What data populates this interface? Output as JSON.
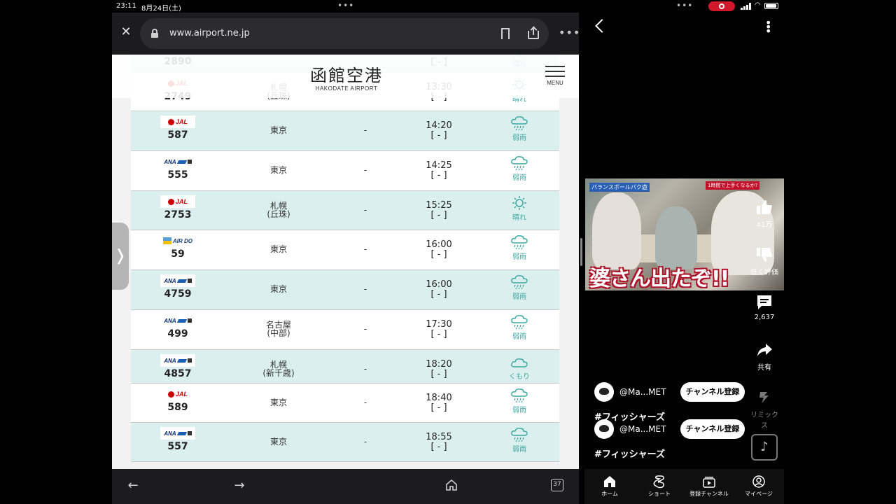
{
  "status_bar": {
    "time": "23:11",
    "date": "8月24日(土)",
    "dots": "•••"
  },
  "browser": {
    "url": "www.airport.ne.jp",
    "close_icon": "close-icon",
    "tabs_count": "37"
  },
  "site": {
    "logo": "函館空港",
    "logo_sub": "HAKODATE AIRPORT",
    "menu_label": "MENU"
  },
  "flights": [
    {
      "airline": "",
      "flight": "2890",
      "dest": "",
      "via": "",
      "time": "",
      "status": "[ - ]",
      "weather": "晴れ",
      "weather_icon": "sun-icon",
      "bg": "teal"
    },
    {
      "airline": "JAL",
      "flight": "2749",
      "dest": "札幌",
      "dest2": "(丘珠)",
      "via": "",
      "time": "13:30",
      "status": "[ - ]",
      "weather": "晴れ",
      "weather_icon": "sun-icon",
      "bg": "white"
    },
    {
      "airline": "JAL",
      "flight": "587",
      "dest": "東京",
      "dest2": "",
      "via": "-",
      "time": "14:20",
      "status": "[ - ]",
      "weather": "弱雨",
      "weather_icon": "rain-icon",
      "bg": "teal"
    },
    {
      "airline": "ANA",
      "flight": "555",
      "dest": "東京",
      "dest2": "",
      "via": "-",
      "time": "14:25",
      "status": "[ - ]",
      "weather": "弱雨",
      "weather_icon": "rain-icon",
      "bg": "white"
    },
    {
      "airline": "JAL",
      "flight": "2753",
      "dest": "札幌",
      "dest2": "(丘珠)",
      "via": "-",
      "time": "15:25",
      "status": "[ - ]",
      "weather": "晴れ",
      "weather_icon": "sun-icon",
      "bg": "teal"
    },
    {
      "airline": "AIRDO",
      "flight": "59",
      "dest": "東京",
      "dest2": "",
      "via": "-",
      "time": "16:00",
      "status": "[ - ]",
      "weather": "弱雨",
      "weather_icon": "rain-icon",
      "bg": "white"
    },
    {
      "airline": "ANA",
      "flight": "4759",
      "dest": "東京",
      "dest2": "",
      "via": "-",
      "time": "16:00",
      "status": "[ - ]",
      "weather": "弱雨",
      "weather_icon": "rain-icon",
      "bg": "teal"
    },
    {
      "airline": "ANA",
      "flight": "499",
      "dest": "名古屋",
      "dest2": "(中部)",
      "via": "-",
      "time": "17:30",
      "status": "[ - ]",
      "weather": "弱雨",
      "weather_icon": "rain-icon",
      "bg": "white"
    },
    {
      "airline": "ANA",
      "flight": "4857",
      "dest": "札幌",
      "dest2": "(新千歳)",
      "via": "-",
      "time": "18:20",
      "status": "[ - ]",
      "weather": "くもり",
      "weather_icon": "cloud-icon",
      "bg": "teal"
    },
    {
      "airline": "JAL",
      "flight": "589",
      "dest": "東京",
      "dest2": "",
      "via": "-",
      "time": "18:40",
      "status": "[ - ]",
      "weather": "弱雨",
      "weather_icon": "rain-icon",
      "bg": "white"
    },
    {
      "airline": "ANA",
      "flight": "557",
      "dest": "東京",
      "dest2": "",
      "via": "-",
      "time": "18:55",
      "status": "[ - ]",
      "weather": "弱雨",
      "weather_icon": "rain-icon",
      "bg": "teal"
    }
  ],
  "airline_labels": {
    "jal": "JAL",
    "ana": "ANA",
    "airdo": "AIR DO"
  },
  "youtube": {
    "video_caption": "婆さん出たぞ!!",
    "video_tag_left": "バランスボールパク遊",
    "video_tag_right": "1時間で上手くなるか?",
    "likes": "41万",
    "dislike_label": "低く評価",
    "comments": "2,637",
    "share_label": "共有",
    "remix_label": "リミックス",
    "channel_handle": "@Ma...MET",
    "subscribe_label": "チャンネル登録",
    "hashtag": "#フィッシャーズ",
    "nav": [
      {
        "label": "ホーム",
        "icon": "home-icon"
      },
      {
        "label": "ショート",
        "icon": "shorts-icon"
      },
      {
        "label": "登録チャンネル",
        "icon": "subscriptions-icon"
      },
      {
        "label": "マイページ",
        "icon": "account-icon"
      }
    ]
  },
  "colors": {
    "teal_row": "#dcefef",
    "weather_teal": "#3aa7a0",
    "jal_red": "#cc0000",
    "ana_blue": "#1a5fb4",
    "recording": "#d3172b"
  }
}
